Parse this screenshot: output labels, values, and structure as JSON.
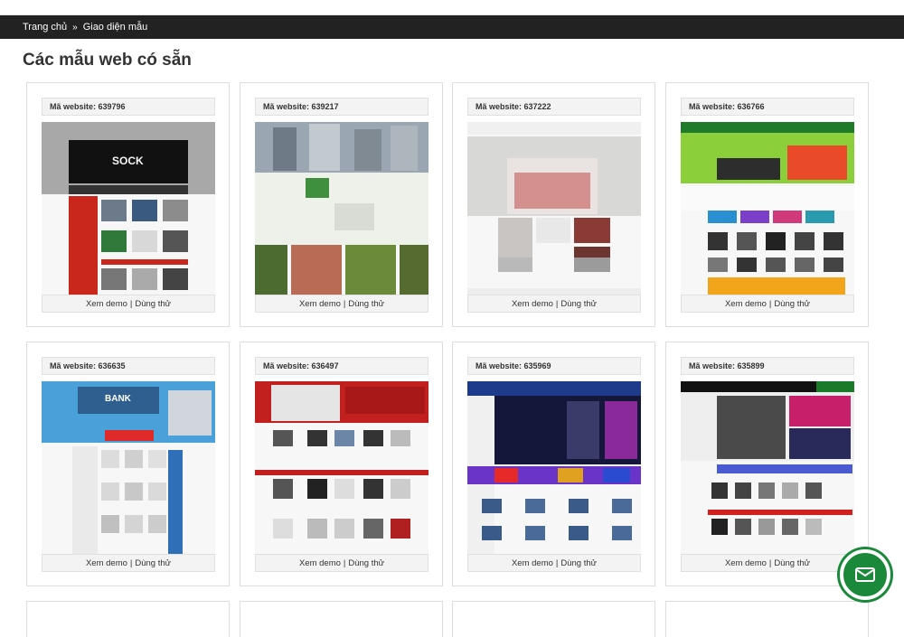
{
  "breadcrumb": {
    "home": "Trang chủ",
    "separator": "»",
    "current": "Giao diện mẫu"
  },
  "page_title": "Các mẫu web có sẵn",
  "templates": [
    {
      "code": "Mã website: 639796",
      "demo": "Xem demo",
      "sep": "|",
      "trial": "Dùng thử"
    },
    {
      "code": "Mã website: 639217",
      "demo": "Xem demo",
      "sep": "|",
      "trial": "Dùng thử"
    },
    {
      "code": "Mã website: 637222",
      "demo": "Xem demo",
      "sep": "|",
      "trial": "Dùng thử"
    },
    {
      "code": "Mã website: 636766",
      "demo": "Xem demo",
      "sep": "|",
      "trial": "Dùng thử"
    },
    {
      "code": "Mã website: 636635",
      "demo": "Xem demo",
      "sep": "|",
      "trial": "Dùng thử"
    },
    {
      "code": "Mã website: 636497",
      "demo": "Xem demo",
      "sep": "|",
      "trial": "Dùng thử"
    },
    {
      "code": "Mã website: 635969",
      "demo": "Xem demo",
      "sep": "|",
      "trial": "Dùng thử"
    },
    {
      "code": "Mã website: 635899",
      "demo": "Xem demo",
      "sep": "|",
      "trial": "Dùng thử"
    }
  ],
  "thumb_texts": {
    "t1_banner": "SOCK",
    "t5_banner": "BANK"
  },
  "fab": {
    "icon": "mail-icon",
    "color": "#1a8a3a"
  }
}
